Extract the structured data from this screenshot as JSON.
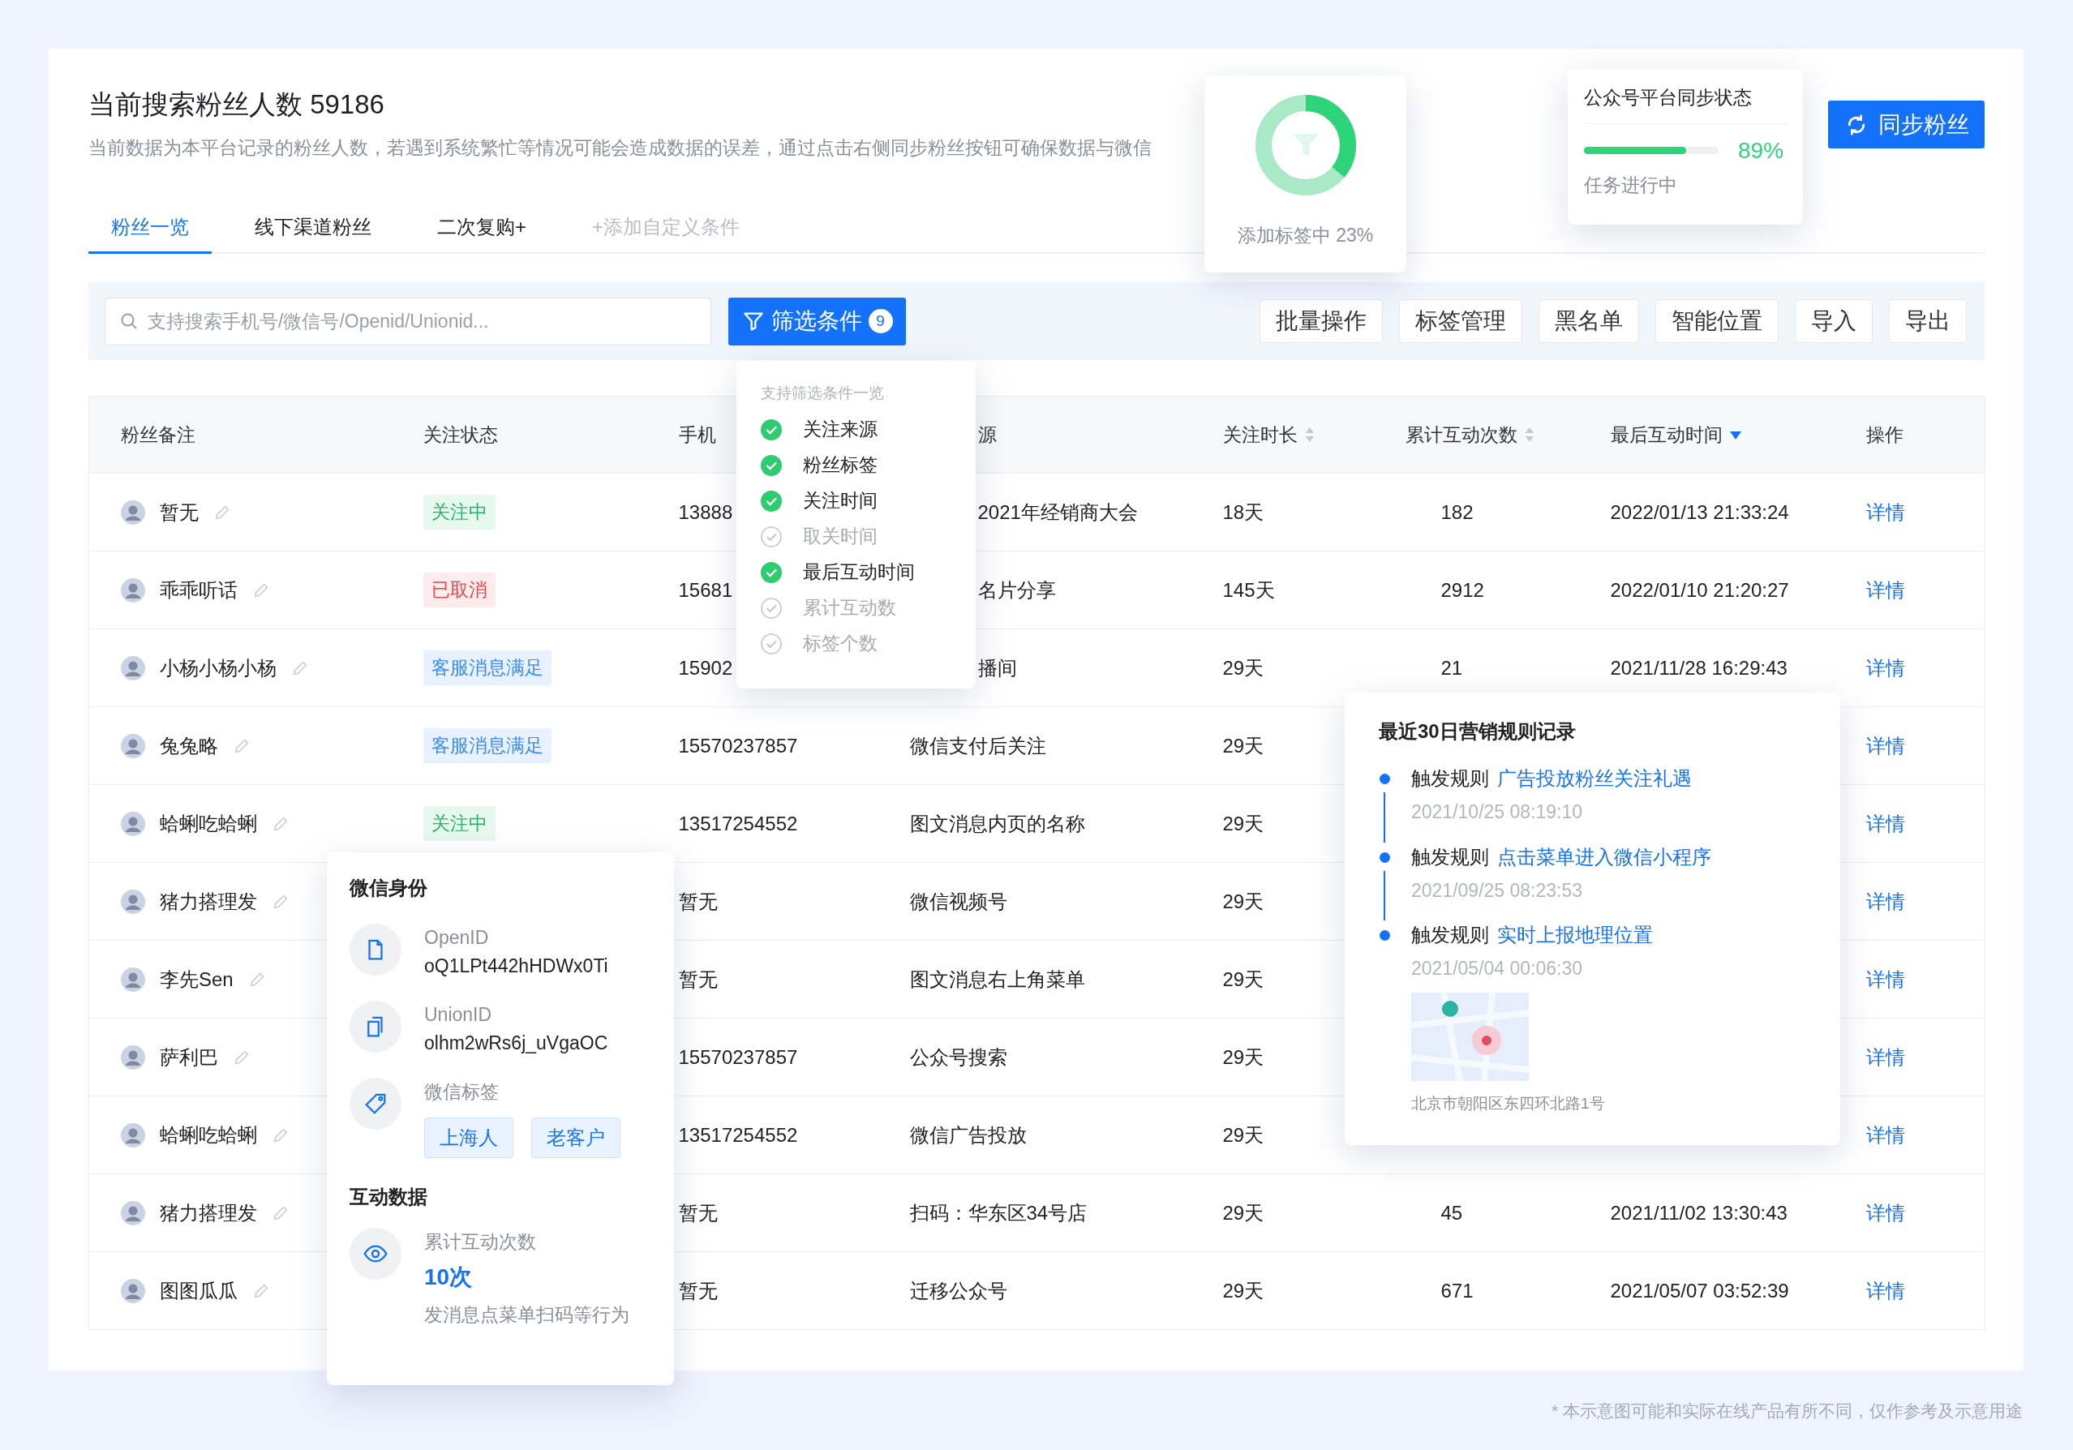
{
  "header": {
    "title": "当前搜索粉丝人数 59186",
    "description": "当前数据为本平台记录的粉丝人数，若遇到系统繁忙等情况可能会造成数据的误差，通过点击右侧同步粉丝按钮可确保数据与微信"
  },
  "sync_button": "同步粉丝",
  "tabs": [
    {
      "label": "粉丝一览",
      "selected": true
    },
    {
      "label": "线下渠道粉丝",
      "selected": false
    },
    {
      "label": "二次复购+",
      "selected": false
    }
  ],
  "add_condition": "+添加自定义条件",
  "search": {
    "placeholder": "支持搜索手机号/微信号/Openid/Unionid..."
  },
  "filter_button": {
    "label": "筛选条件",
    "count": "9"
  },
  "actions": [
    "批量操作",
    "标签管理",
    "黑名单",
    "智能位置",
    "导入",
    "导出"
  ],
  "table": {
    "columns": [
      {
        "label": "粉丝备注"
      },
      {
        "label": "关注状态"
      },
      {
        "label": "手机"
      },
      {
        "label": "源"
      },
      {
        "label": "关注时长",
        "sortable": true,
        "sort_active": false
      },
      {
        "label": "累计互动次数",
        "sortable": true,
        "sort_active": false
      },
      {
        "label": "最后互动时间",
        "sortable": true,
        "sort_active": true
      },
      {
        "label": "操作"
      }
    ],
    "rows": [
      {
        "name": "暂无",
        "status": {
          "text": "关注中",
          "kind": "following"
        },
        "phone": "13888",
        "source": "2021年经销商大会",
        "duration": "18天",
        "interactions": "182",
        "last_time": "2022/01/13 21:33:24",
        "action": "详情"
      },
      {
        "name": "乖乖听话",
        "status": {
          "text": "已取消",
          "kind": "cancelled"
        },
        "phone": "15681",
        "source": "名片分享",
        "duration": "145天",
        "interactions": "2912",
        "last_time": "2022/01/10 21:20:27",
        "action": "详情"
      },
      {
        "name": "小杨小杨小杨",
        "status": {
          "text": "客服消息满足",
          "kind": "service"
        },
        "phone": "15902",
        "source": "播间",
        "duration": "29天",
        "interactions": "21",
        "last_time": "2021/11/28 16:29:43",
        "action": "详情"
      },
      {
        "name": "兔兔略",
        "status": {
          "text": "客服消息满足",
          "kind": "service"
        },
        "phone": "15570237857",
        "source": "微信支付后关注",
        "duration": "29天",
        "action": "详情"
      },
      {
        "name": "蛤蜊吃蛤蜊",
        "status": {
          "text": "关注中",
          "kind": "following"
        },
        "phone": "13517254552",
        "source": "图文消息内页的名称",
        "duration": "29天",
        "action": "详情"
      },
      {
        "name": "猪力搭理发",
        "phone": "暂无",
        "source": "微信视频号",
        "duration": "29天",
        "action": "详情"
      },
      {
        "name": "李先Sen",
        "phone": "暂无",
        "source": "图文消息右上角菜单",
        "duration": "29天",
        "action": "详情"
      },
      {
        "name": "萨利巴",
        "phone": "15570237857",
        "source": "公众号搜索",
        "duration": "29天",
        "action": "详情"
      },
      {
        "name": "蛤蜊吃蛤蜊",
        "phone": "13517254552",
        "source": "微信广告投放",
        "duration": "29天",
        "action": "详情"
      },
      {
        "name": "猪力搭理发",
        "phone": "暂无",
        "source": "扫码：华东区34号店",
        "duration": "29天",
        "interactions": "45",
        "last_time": "2021/11/02 13:30:43",
        "action": "详情"
      },
      {
        "name": "图图瓜瓜",
        "phone": "暂无",
        "source": "迁移公众号",
        "duration": "29天",
        "interactions": "671",
        "last_time": "2021/05/07 03:52:39",
        "action": "详情"
      }
    ]
  },
  "task_popover": {
    "level": 0.36,
    "label": "添加标签中 23%"
  },
  "sync_status": {
    "title": "公众号平台同步状态",
    "level": 0.76,
    "percent": "89%",
    "status": "任务进行中"
  },
  "filter_menu": {
    "title": "支持筛选条件一览",
    "items": [
      {
        "label": "关注来源",
        "checked": true
      },
      {
        "label": "粉丝标签",
        "checked": true
      },
      {
        "label": "关注时间",
        "checked": true
      },
      {
        "label": "取关时间",
        "checked": false
      },
      {
        "label": "最后互动时间",
        "checked": true
      },
      {
        "label": "累计互动数",
        "checked": false
      },
      {
        "label": "标签个数",
        "checked": false
      }
    ]
  },
  "identity_card": {
    "title": "微信身份",
    "fields": [
      {
        "kind": "file",
        "label": "OpenID",
        "value": "oQ1LPt442hHDWx0Ti"
      },
      {
        "kind": "copy",
        "label": "UnionID",
        "value": "olhm2wRs6j_uVgaOC"
      },
      {
        "kind": "tag",
        "label": "微信标签",
        "tags": [
          "上海人",
          "老客户"
        ]
      }
    ],
    "stats_title": "互动数据",
    "stats": [
      {
        "kind": "view",
        "label": "累计互动次数",
        "value": "10次",
        "note": "发消息点菜单扫码等行为"
      }
    ]
  },
  "marketing_card": {
    "title": "最近30日营销规则记录",
    "events": [
      {
        "prefix": "触发规则",
        "rule": "广告投放粉丝关注礼遇",
        "time": "2021/10/25 08:19:10"
      },
      {
        "prefix": "触发规则",
        "rule": "点击菜单进入微信小程序",
        "time": "2021/09/25 08:23:53"
      },
      {
        "prefix": "触发规则",
        "rule": "实时上报地理位置",
        "time": "2021/05/04 00:06:30",
        "address": "北京市朝阳区东四环北路1号"
      }
    ]
  },
  "footnote": "* 本示意图可能和实际在线产品有所不同，仅作参考及示意用途"
}
